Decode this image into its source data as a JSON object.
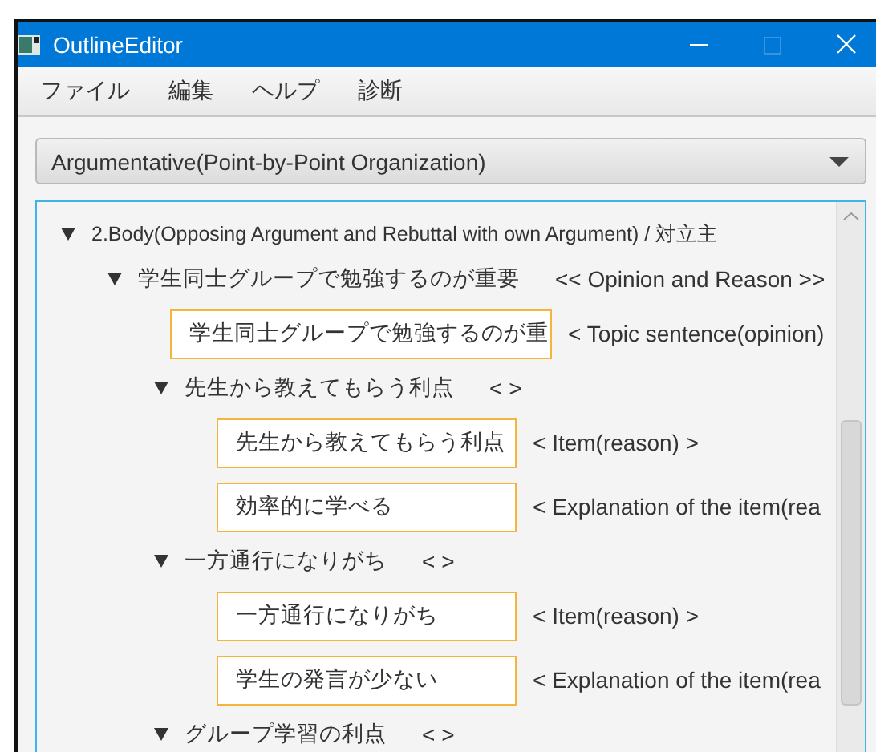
{
  "window": {
    "title": "OutlineEditor"
  },
  "menu": [
    {
      "label": "ファイル"
    },
    {
      "label": "編集"
    },
    {
      "label": "ヘルプ"
    },
    {
      "label": "診断"
    }
  ],
  "template_select": {
    "value": "Argumentative(Point-by-Point Organization)"
  },
  "outline": [
    {
      "kind": "branch",
      "label": "2.Body(Opposing Argument and Rebuttal with own Argument) / 対立主",
      "expanded": true,
      "children": [
        {
          "kind": "branch",
          "label": "学生同士グループで勉強するのが重要",
          "tag": "<< Opinion and Reason >>",
          "expanded": true,
          "children": [
            {
              "kind": "field",
              "value": "学生同士グループで勉強するのが重",
              "tag": "< Topic sentence(opinion)"
            },
            {
              "kind": "branch",
              "label": "先生から教えてもらう利点",
              "tag": "<  >",
              "expanded": true,
              "children": [
                {
                  "kind": "field",
                  "value": "先生から教えてもらう利点",
                  "tag": "< Item(reason) >"
                },
                {
                  "kind": "field",
                  "value": "効率的に学べる",
                  "tag": "< Explanation of the item(rea"
                }
              ]
            },
            {
              "kind": "branch",
              "label": "一方通行になりがち",
              "tag": "<  >",
              "expanded": true,
              "children": [
                {
                  "kind": "field",
                  "value": "一方通行になりがち",
                  "tag": "< Item(reason) >"
                },
                {
                  "kind": "field",
                  "value": "学生の発言が少ない",
                  "tag": "< Explanation of the item(rea"
                }
              ]
            },
            {
              "kind": "branch",
              "label": "グループ学習の利点",
              "tag": "<  >",
              "expanded": true
            }
          ]
        }
      ]
    }
  ]
}
